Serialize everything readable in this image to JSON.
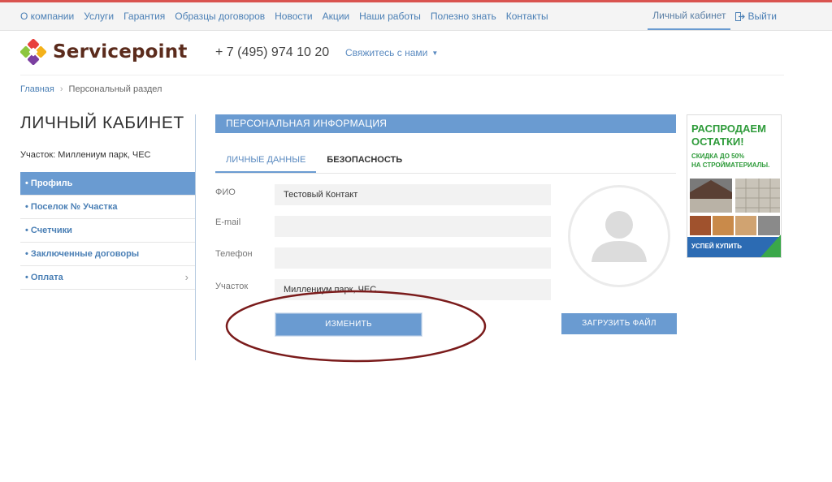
{
  "topnav": {
    "items": [
      "О компании",
      "Услуги",
      "Гарантия",
      "Образцы договоров",
      "Новости",
      "Акции",
      "Наши работы",
      "Полезно знать",
      "Контакты"
    ],
    "cabinet_label": "Личный кабинет",
    "logout_label": "Выйти"
  },
  "header": {
    "logo_text": "Servicepoint",
    "phone": "+ 7 (495) 974 10 20",
    "contact_label": "Свяжитесь с нами"
  },
  "breadcrumb": {
    "home": "Главная",
    "current": "Персональный раздел"
  },
  "sidebar": {
    "title": "ЛИЧНЫЙ КАБИНЕТ",
    "plot_info": "Участок: Миллениум парк, ЧЕС",
    "items": [
      {
        "label": "• Профиль",
        "active": true
      },
      {
        "label": "• Поселок № Участка",
        "active": false
      },
      {
        "label": "• Счетчики",
        "active": false
      },
      {
        "label": "• Заключенные договоры",
        "active": false
      },
      {
        "label": "• Оплата",
        "active": false
      }
    ]
  },
  "main": {
    "panel_title": "ПЕРСОНАЛЬНАЯ ИНФОРМАЦИЯ",
    "tabs": [
      {
        "label": "ЛИЧНЫЕ ДАННЫЕ",
        "active": true
      },
      {
        "label": "БЕЗОПАСНОСТЬ",
        "active": false
      }
    ],
    "fields": [
      {
        "label": "ФИО",
        "value": "Тестовый Контакт"
      },
      {
        "label": "E-mail",
        "value": ""
      },
      {
        "label": "Телефон",
        "value": ""
      },
      {
        "label": "Участок",
        "value": "Миллениум парк, ЧЕС"
      }
    ],
    "edit_button": "ИЗМЕНИТЬ",
    "upload_button": "ЗАГРУЗИТЬ ФАЙЛ"
  },
  "banner": {
    "title_line1": "РАСПРОДАЕМ",
    "title_line2": "ОСТАТКИ!",
    "subtitle_line1": "СКИДКА ДО 50%",
    "subtitle_line2": "НА СТРОЙМАТЕРИАЛЫ.",
    "cta": "УСПЕЙ КУПИТЬ"
  },
  "colors": {
    "accent": "#6a9bd1",
    "link": "#4a7fb5",
    "annotation": "#7a1b1b",
    "banner_green": "#2e9b3a"
  }
}
